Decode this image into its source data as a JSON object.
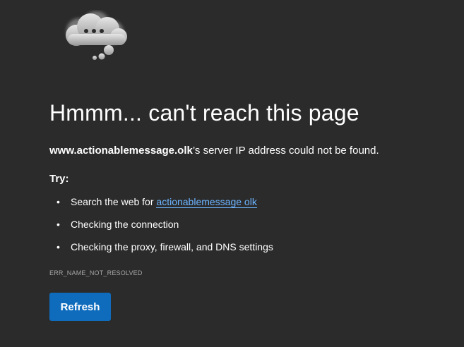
{
  "error_page": {
    "icon": "cloud-thought-icon",
    "headline": "Hmmm... can't reach this page",
    "message_host": "www.actionablemessage.olk",
    "message_rest": "’s server IP address could not be found.",
    "try_label": "Try:",
    "suggestions": {
      "search_prefix": "Search the web for ",
      "search_link": "actionablemessage olk",
      "connection": "Checking the connection",
      "proxy": "Checking the proxy, firewall, and DNS settings"
    },
    "bullet": "•",
    "error_code": "ERR_NAME_NOT_RESOLVED",
    "refresh_label": "Refresh"
  },
  "colors": {
    "background": "#2b2b2b",
    "link": "#6cb4ff",
    "button": "#0f6cbd",
    "muted_text": "#a6a6a6"
  }
}
